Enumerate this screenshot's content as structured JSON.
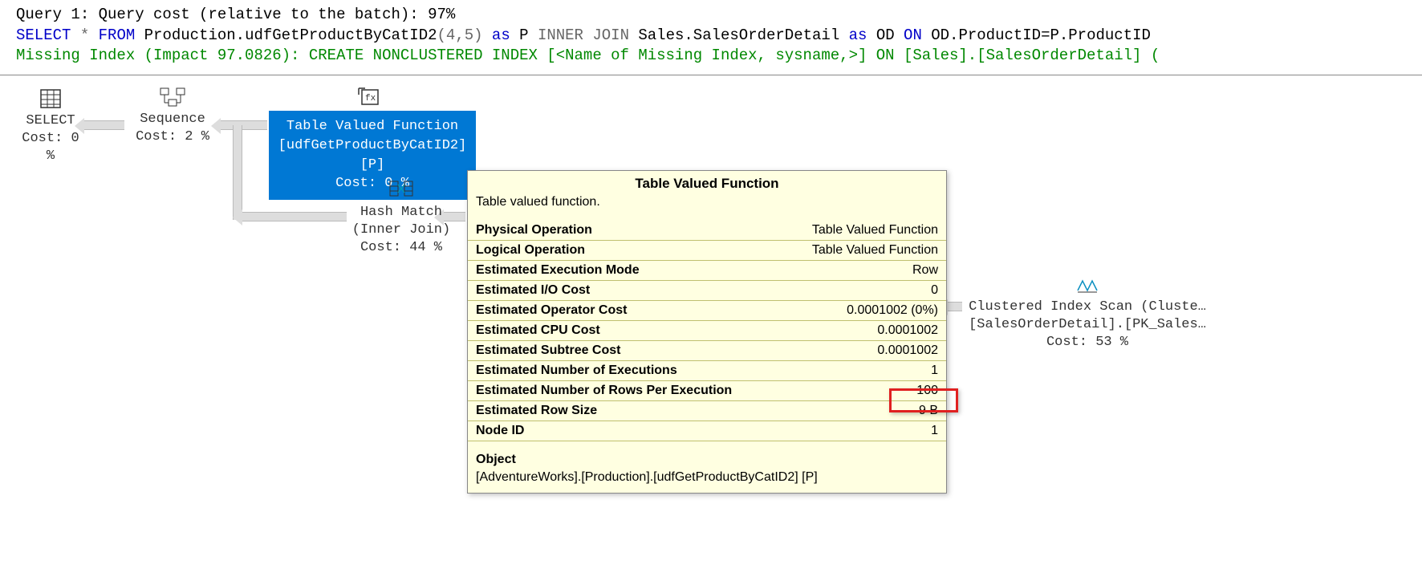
{
  "header": {
    "line1": "Query 1: Query cost (relative to the batch): 97%",
    "sql_prefix": "SELECT ",
    "sql_star": "*",
    "sql_mid1": " FROM ",
    "sql_obj1": "Production.udfGetProductByCatID2",
    "sql_args": "(4,5)",
    "sql_mid2": " as ",
    "sql_alias1": "P",
    "sql_join": " INNER JOIN ",
    "sql_obj2": "Sales.SalesOrderDetail",
    "sql_mid3": " as ",
    "sql_alias2": "OD",
    "sql_on": " ON ",
    "sql_cond": "OD.ProductID=P.ProductID",
    "missing_index": "Missing Index (Impact 97.0826): CREATE NONCLUSTERED INDEX [<Name of Missing Index, sysname,>] ON [Sales].[SalesOrderDetail] ("
  },
  "nodes": {
    "select": {
      "label": "SELECT",
      "cost": "Cost: 0 %"
    },
    "sequence": {
      "label": "Sequence",
      "cost": "Cost: 2 %"
    },
    "tvf": {
      "line1": "Table Valued Function",
      "line2": "[udfGetProductByCatID2] [P]",
      "line3": "Cost: 0 %"
    },
    "hash": {
      "label": "Hash Match",
      "sub": "(Inner Join)",
      "cost": "Cost: 44 %"
    },
    "scan": {
      "line1": "Clustered Index Scan (Cluste…",
      "line2": "[SalesOrderDetail].[PK_Sales…",
      "line3": "Cost: 53 %"
    }
  },
  "tooltip": {
    "title": "Table Valued Function",
    "desc": "Table valued function.",
    "rows": [
      {
        "k": "Physical Operation",
        "v": "Table Valued Function"
      },
      {
        "k": "Logical Operation",
        "v": "Table Valued Function"
      },
      {
        "k": "Estimated Execution Mode",
        "v": "Row"
      },
      {
        "k": "Estimated I/O Cost",
        "v": "0"
      },
      {
        "k": "Estimated Operator Cost",
        "v": "0.0001002 (0%)"
      },
      {
        "k": "Estimated CPU Cost",
        "v": "0.0001002"
      },
      {
        "k": "Estimated Subtree Cost",
        "v": "0.0001002"
      },
      {
        "k": "Estimated Number of Executions",
        "v": "1"
      },
      {
        "k": "Estimated Number of Rows Per Execution",
        "v": "100"
      },
      {
        "k": "Estimated Row Size",
        "v": "9 B"
      },
      {
        "k": "Node ID",
        "v": "1"
      }
    ],
    "object_label": "Object",
    "object_value": "[AdventureWorks].[Production].[udfGetProductByCatID2] [P]"
  }
}
